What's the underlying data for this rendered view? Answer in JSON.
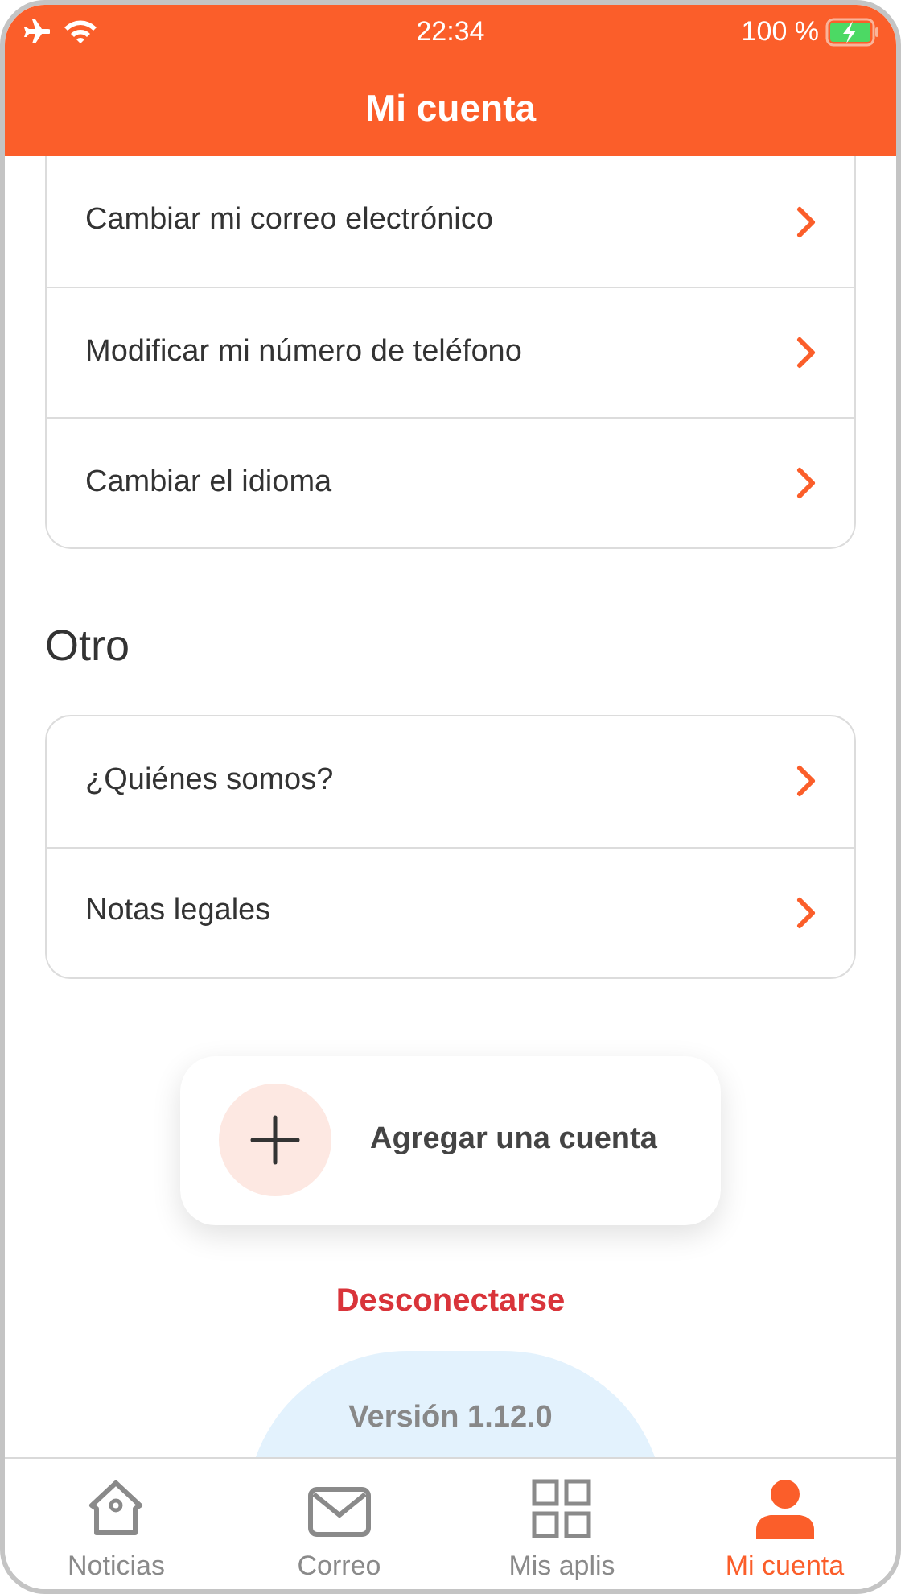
{
  "status_bar": {
    "time": "22:34",
    "battery": "100 %"
  },
  "header": {
    "title": "Mi cuenta"
  },
  "sections": [
    {
      "items": [
        {
          "label": "Cambiar mi correo electrónico"
        },
        {
          "label": "Modificar mi número de teléfono"
        },
        {
          "label": "Cambiar el idioma"
        }
      ]
    },
    {
      "title": "Otro",
      "items": [
        {
          "label": "¿Quiénes somos?"
        },
        {
          "label": "Notas legales"
        }
      ]
    }
  ],
  "add_account": {
    "label": "Agregar una cuenta"
  },
  "logout": {
    "label": "Desconectarse"
  },
  "version": "Versión 1.12.0",
  "tabs": [
    {
      "kind": "home",
      "label": "Noticias",
      "selected": false
    },
    {
      "kind": "mail",
      "label": "Correo",
      "selected": false
    },
    {
      "kind": "apps",
      "label": "Mis aplis",
      "selected": false
    },
    {
      "kind": "account",
      "label": "Mi cuenta",
      "selected": true
    }
  ]
}
